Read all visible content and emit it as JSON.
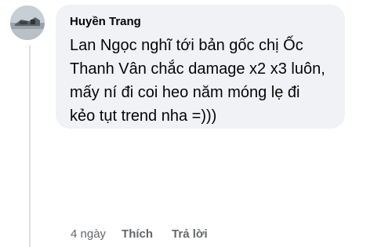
{
  "comment": {
    "author": "Huyền Trang",
    "text": "Lan Ngọc nghĩ tới bản gốc chị Ốc Thanh Vân chắc damage x2 x3 luôn, mấy ní đi coi heo năm móng lẹ đi kẻo tụt trend nha =)))",
    "timestamp": "4 ngày",
    "like_label": "Thích",
    "reply_label": "Trả lời"
  },
  "colors": {
    "bubble_background": "#f0f2f5",
    "text_primary": "#050505",
    "text_secondary": "#65676b",
    "thread_line": "#dcdfe3"
  },
  "icons": {
    "avatar": "profile-photo-avatar"
  }
}
